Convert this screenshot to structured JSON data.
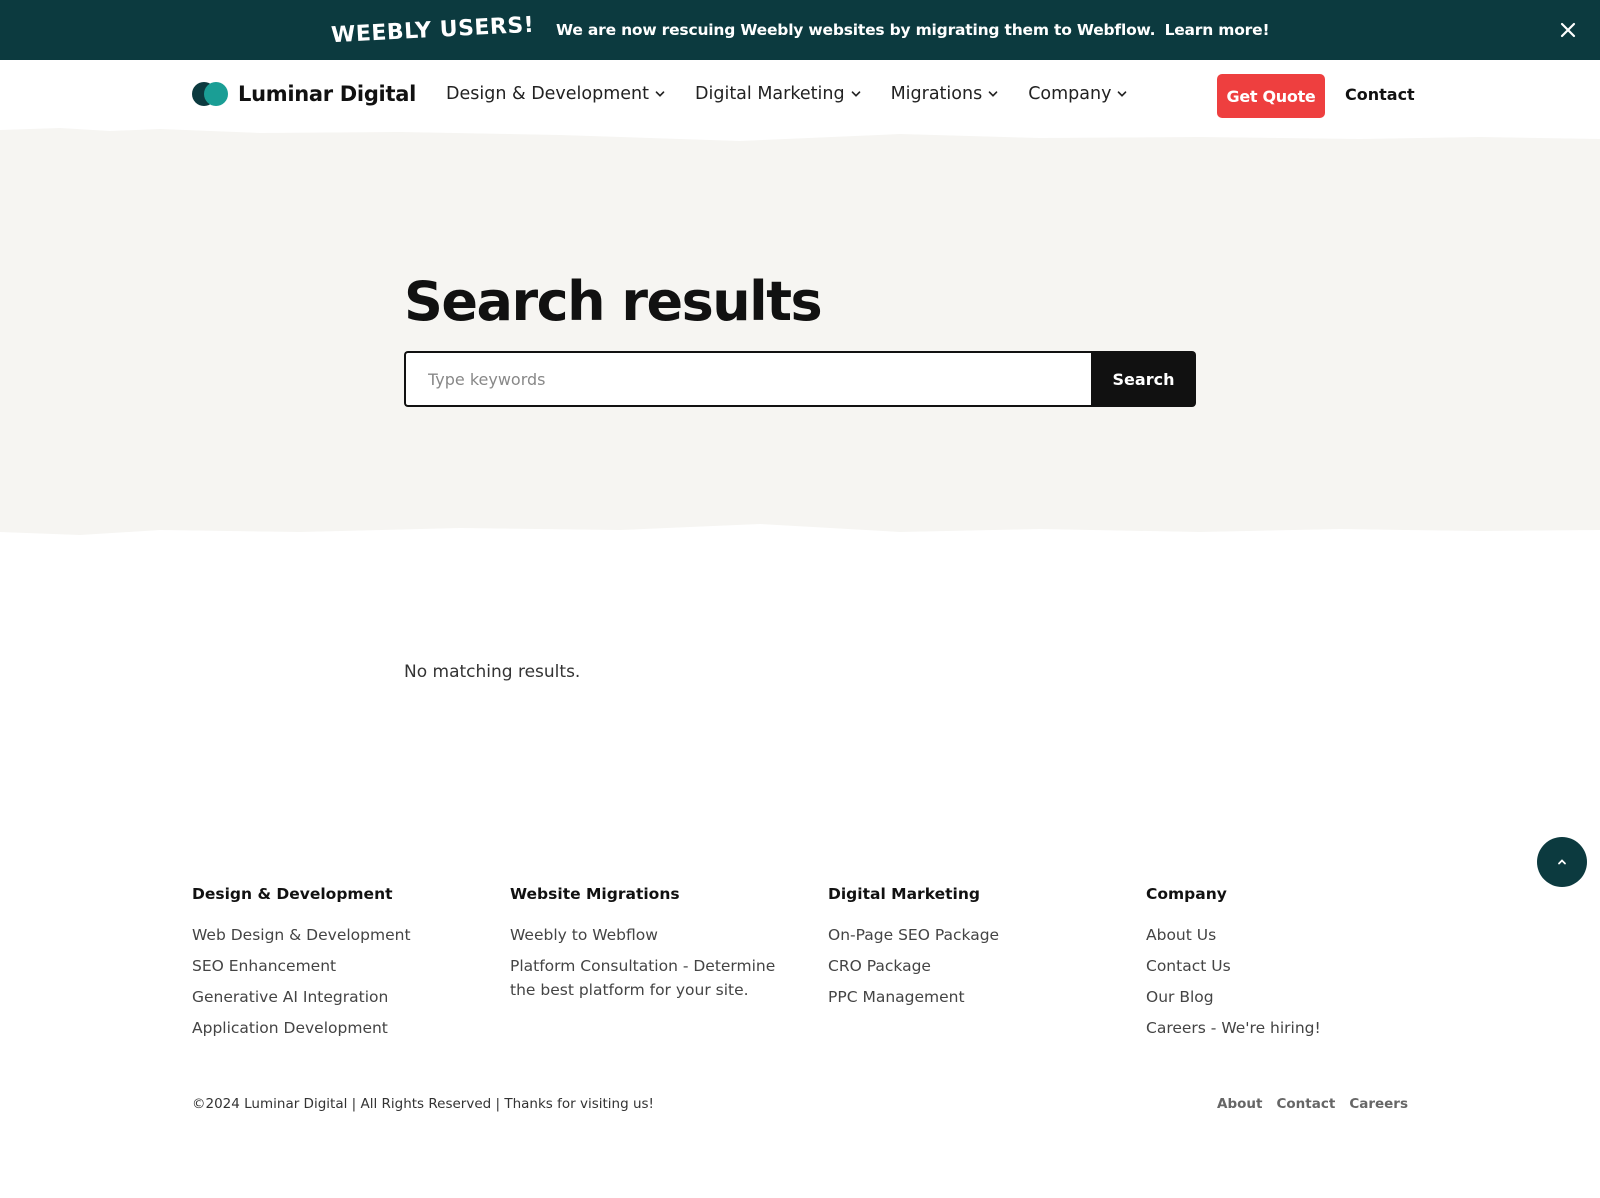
{
  "banner": {
    "badge": "WEEBLY USERS!",
    "text": "We are now rescuing Weebly websites by migrating them to Webflow.",
    "link": "Learn more!",
    "close_icon": "close-icon"
  },
  "brand": {
    "name": "Luminar Digital",
    "colors": {
      "dark_teal": "#0c3a3f",
      "teal": "#1a9e95",
      "red": "#ee3f3f",
      "hero_bg": "#f6f5f2"
    }
  },
  "nav": {
    "items": [
      {
        "label": "Design & Development",
        "icon": "chevron-down-icon"
      },
      {
        "label": "Digital Marketing",
        "icon": "chevron-down-icon"
      },
      {
        "label": "Migrations",
        "icon": "chevron-down-icon"
      },
      {
        "label": "Company",
        "icon": "chevron-down-icon"
      }
    ],
    "quote_button": "Get Quote",
    "contact_link": "Contact"
  },
  "hero": {
    "title": "Search results",
    "search_placeholder": "Type keywords",
    "search_value": "",
    "search_button": "Search"
  },
  "results": {
    "message": "No matching results."
  },
  "back_to_top": {
    "icon": "chevron-up-icon"
  },
  "footer": {
    "columns": [
      {
        "title": "Design & Development",
        "links": [
          "Web Design & Development",
          "SEO Enhancement",
          "Generative AI Integration",
          "Application Development"
        ]
      },
      {
        "title": "Website Migrations",
        "links": [
          "Weebly to Webflow",
          "Platform Consultation - Determine the best platform for your site."
        ]
      },
      {
        "title": "Digital Marketing",
        "links": [
          "On-Page SEO Package",
          "CRO Package",
          "PPC Management"
        ]
      },
      {
        "title": "Company",
        "links": [
          "About Us",
          "Contact Us",
          "Our Blog",
          "Careers - We're hiring!"
        ]
      }
    ],
    "copyright": "©2024 Luminar Digital | All Rights Reserved | Thanks for visiting us!",
    "bottom_links": [
      "About",
      "Contact",
      "Careers"
    ]
  }
}
